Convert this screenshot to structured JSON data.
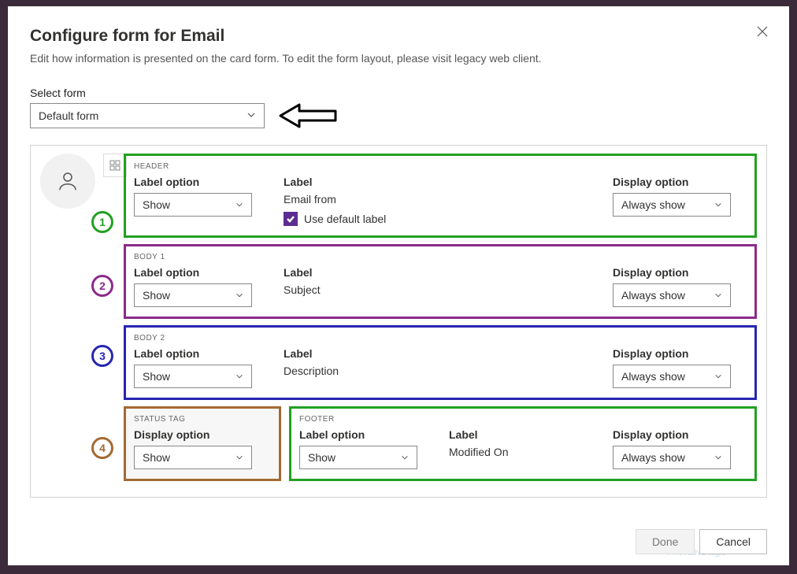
{
  "dialog": {
    "title": "Configure form for Email",
    "subtitle": "Edit how information is presented on the card form. To edit the form layout, please visit legacy web client.",
    "select_form_label": "Select form",
    "select_form_value": "Default form"
  },
  "labels": {
    "label_option": "Label option",
    "label": "Label",
    "display_option": "Display option",
    "use_default": "Use default label"
  },
  "options": {
    "show": "Show",
    "always_show": "Always show"
  },
  "sections": {
    "header": {
      "title": "HEADER",
      "label_value": "Email from",
      "use_default_checked": true
    },
    "body1": {
      "title": "BODY 1",
      "label_value": "Subject"
    },
    "body2": {
      "title": "BODY 2",
      "label_value": "Description"
    },
    "status": {
      "title": "STATUS TAG"
    },
    "footer": {
      "title": "FOOTER",
      "label_value": "Modified On"
    }
  },
  "badges": {
    "b1": "1",
    "b2": "2",
    "b3": "3",
    "b4": "4"
  },
  "footer_btns": {
    "done": "Done",
    "cancel": "Cancel"
  },
  "watermark": "innovative logic"
}
